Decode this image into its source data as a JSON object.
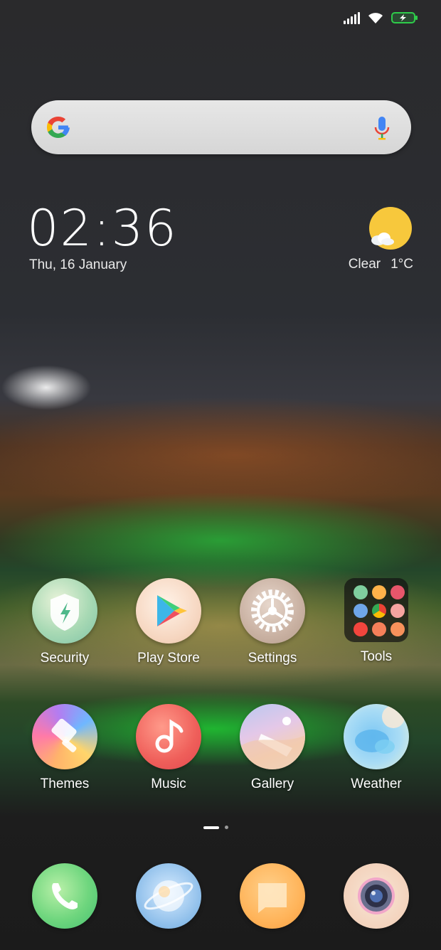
{
  "status_bar": {
    "icons": [
      "signal-icon",
      "wifi-icon",
      "battery-charging-icon"
    ],
    "battery_color": "#2ecc4a"
  },
  "search_widget": {
    "logo": "google-g-icon",
    "voice": "mic-icon"
  },
  "clock_widget": {
    "time": "02:36",
    "date": "Thu, 16 January"
  },
  "weather_widget": {
    "icon": "sun-cloud-icon",
    "condition": "Clear",
    "temperature": "1°C"
  },
  "apps_row1": [
    {
      "label": "Security",
      "icon": "shield-bolt-icon"
    },
    {
      "label": "Play Store",
      "icon": "play-store-icon"
    },
    {
      "label": "Settings",
      "icon": "gear-icon"
    },
    {
      "label": "Tools",
      "icon": "folder-icon"
    }
  ],
  "apps_row2": [
    {
      "label": "Themes",
      "icon": "brush-icon"
    },
    {
      "label": "Music",
      "icon": "music-note-icon"
    },
    {
      "label": "Gallery",
      "icon": "gallery-icon"
    },
    {
      "label": "Weather",
      "icon": "weather-icon"
    }
  ],
  "page_indicator": {
    "pages": 2,
    "current": 1
  },
  "dock": [
    {
      "icon": "phone-icon"
    },
    {
      "icon": "browser-icon"
    },
    {
      "icon": "messages-icon"
    },
    {
      "icon": "camera-icon"
    }
  ]
}
